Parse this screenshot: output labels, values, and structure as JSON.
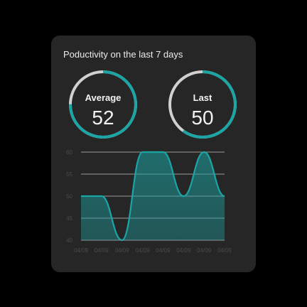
{
  "card": {
    "title": "Poductivity on the last 7 days"
  },
  "gauges": [
    {
      "label": "Average",
      "value": "52",
      "fraction": 0.75
    },
    {
      "label": "Last",
      "value": "50",
      "fraction": 0.6
    }
  ],
  "colors": {
    "accent": "#1ba5a5",
    "ring_track": "#d0d0d0",
    "card_bg": "#262626",
    "page_bg": "#000000",
    "grid": "#9a9a9a",
    "tick_text": "#4a4a4a"
  },
  "chart_data": {
    "type": "area",
    "title": "",
    "xlabel": "",
    "ylabel": "",
    "x": [
      "04/09",
      "04/09",
      "04/09",
      "04/09",
      "04/09",
      "04/09",
      "04/09",
      "04/09"
    ],
    "series": [
      {
        "values": [
          50,
          50,
          40,
          60,
          60,
          50,
          60,
          50
        ]
      }
    ],
    "yticks": [
      60,
      55,
      50,
      45,
      40
    ],
    "ylim": [
      40,
      60
    ],
    "grid": true,
    "legend": "none"
  }
}
